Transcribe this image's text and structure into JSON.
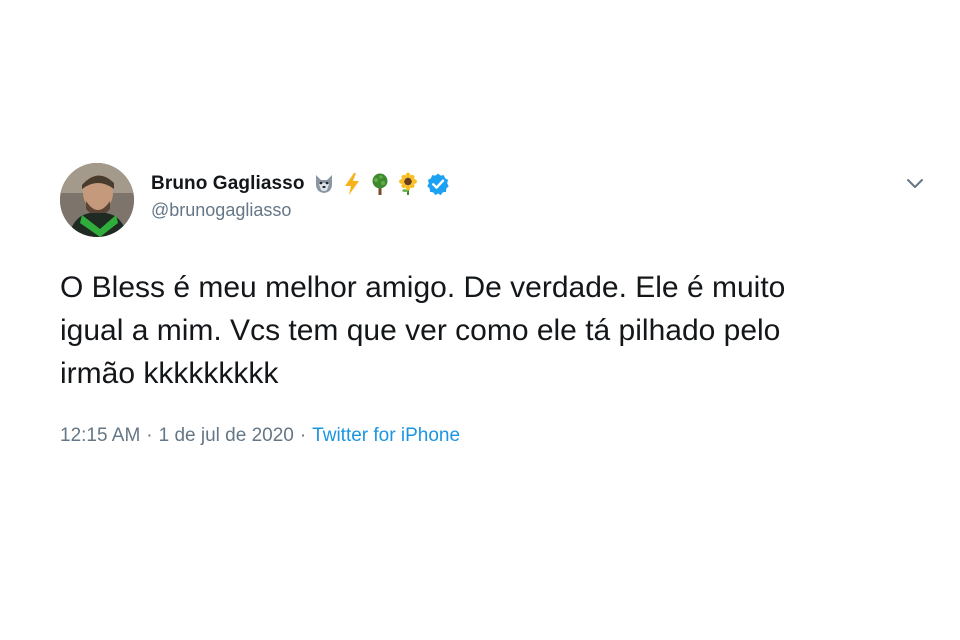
{
  "author": {
    "display_name": "Bruno Gagliasso",
    "handle": "@brunogagliasso",
    "name_emojis": [
      "wolf-emoji",
      "high-voltage-emoji",
      "tree-emoji",
      "sunflower-emoji"
    ],
    "verified": true
  },
  "tweet": {
    "text": "O Bless é meu melhor amigo. De verdade. Ele é muito\nigual a mim. Vcs tem que ver como ele tá pilhado pelo\nirmão kkkkkkkkk"
  },
  "meta": {
    "time": "12:15 AM",
    "separator_1": "·",
    "date": "1 de jul de 2020",
    "separator_2": "·",
    "source": "Twitter for iPhone"
  },
  "icons": {
    "more": "chevron-down-icon",
    "verified": "verified-badge-icon"
  },
  "colors": {
    "primary_text": "#14171a",
    "secondary_text": "#657786",
    "link": "#1b95e0",
    "verified": "#1da1f2"
  }
}
